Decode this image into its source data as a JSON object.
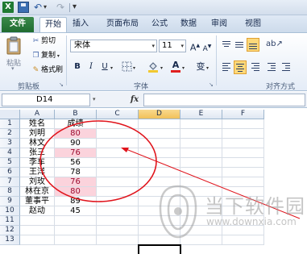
{
  "window": {
    "app_icon": "excel-logo-icon",
    "logo_letter": "X"
  },
  "tabs": [
    {
      "label": "文件"
    },
    {
      "label": "开始"
    },
    {
      "label": "插入"
    },
    {
      "label": "页面布局"
    },
    {
      "label": "公式"
    },
    {
      "label": "数据"
    },
    {
      "label": "审阅"
    },
    {
      "label": "视图"
    }
  ],
  "ribbon": {
    "clipboard": {
      "paste_label": "粘贴",
      "cut_label": "剪切",
      "copy_label": "复制",
      "format_painter_label": "格式刷",
      "group_label": "剪贴板"
    },
    "font": {
      "font_name": "宋体",
      "font_size": "11",
      "bold": "B",
      "italic": "I",
      "underline": "U",
      "grow": "A",
      "shrink": "A",
      "font_color_letter": "A",
      "wen_label": "变",
      "group_label": "字体",
      "font_color": "#e02020",
      "fill_color": "#f2c830"
    },
    "alignment": {
      "group_label": "对齐方式"
    }
  },
  "formula_bar": {
    "name_box": "D14",
    "fx": "fx",
    "value": ""
  },
  "spreadsheet": {
    "columns": [
      "A",
      "B",
      "C",
      "D",
      "E",
      "F"
    ],
    "rows": [
      {
        "n": "1",
        "a": "姓名",
        "b": "成绩",
        "pink": false
      },
      {
        "n": "2",
        "a": "刘明",
        "b": "80",
        "pink": true
      },
      {
        "n": "3",
        "a": "林文",
        "b": "90",
        "pink": false
      },
      {
        "n": "4",
        "a": "张三",
        "b": "76",
        "pink": true
      },
      {
        "n": "5",
        "a": "李车",
        "b": "56",
        "pink": false
      },
      {
        "n": "6",
        "a": "王洋",
        "b": "78",
        "pink": false
      },
      {
        "n": "7",
        "a": "刘玫",
        "b": "76",
        "pink": true
      },
      {
        "n": "8",
        "a": "林在京",
        "b": "80",
        "pink": true
      },
      {
        "n": "9",
        "a": "董事平",
        "b": "89",
        "pink": false
      },
      {
        "n": "10",
        "a": "赵动",
        "b": "45",
        "pink": false
      },
      {
        "n": "11",
        "a": "",
        "b": "",
        "pink": false
      },
      {
        "n": "12",
        "a": "",
        "b": "",
        "pink": false
      },
      {
        "n": "13",
        "a": "",
        "b": "",
        "pink": false
      }
    ],
    "pink_fill": "#fbd3dc",
    "pink_text": "#9c0a2e",
    "selected_column": "D"
  },
  "annotation": {
    "color": "#e0141c",
    "shapes": [
      "ellipse",
      "arrow"
    ]
  },
  "watermark": {
    "title": "当下软件园",
    "url": "www.downxia.com"
  }
}
